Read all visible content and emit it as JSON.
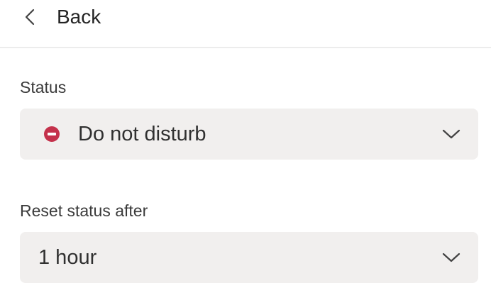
{
  "header": {
    "back_label": "Back"
  },
  "status": {
    "label": "Status",
    "selected_value": "Do not disturb",
    "indicator_icon": "dnd-status-icon",
    "indicator_color": "#c4314b"
  },
  "reset": {
    "label": "Reset status after",
    "selected_value": "1 hour"
  },
  "icons": {
    "back": "chevron-left-icon",
    "dropdown": "chevron-down-icon"
  },
  "colors": {
    "field_background": "#f1efee",
    "divider": "#ececec"
  }
}
